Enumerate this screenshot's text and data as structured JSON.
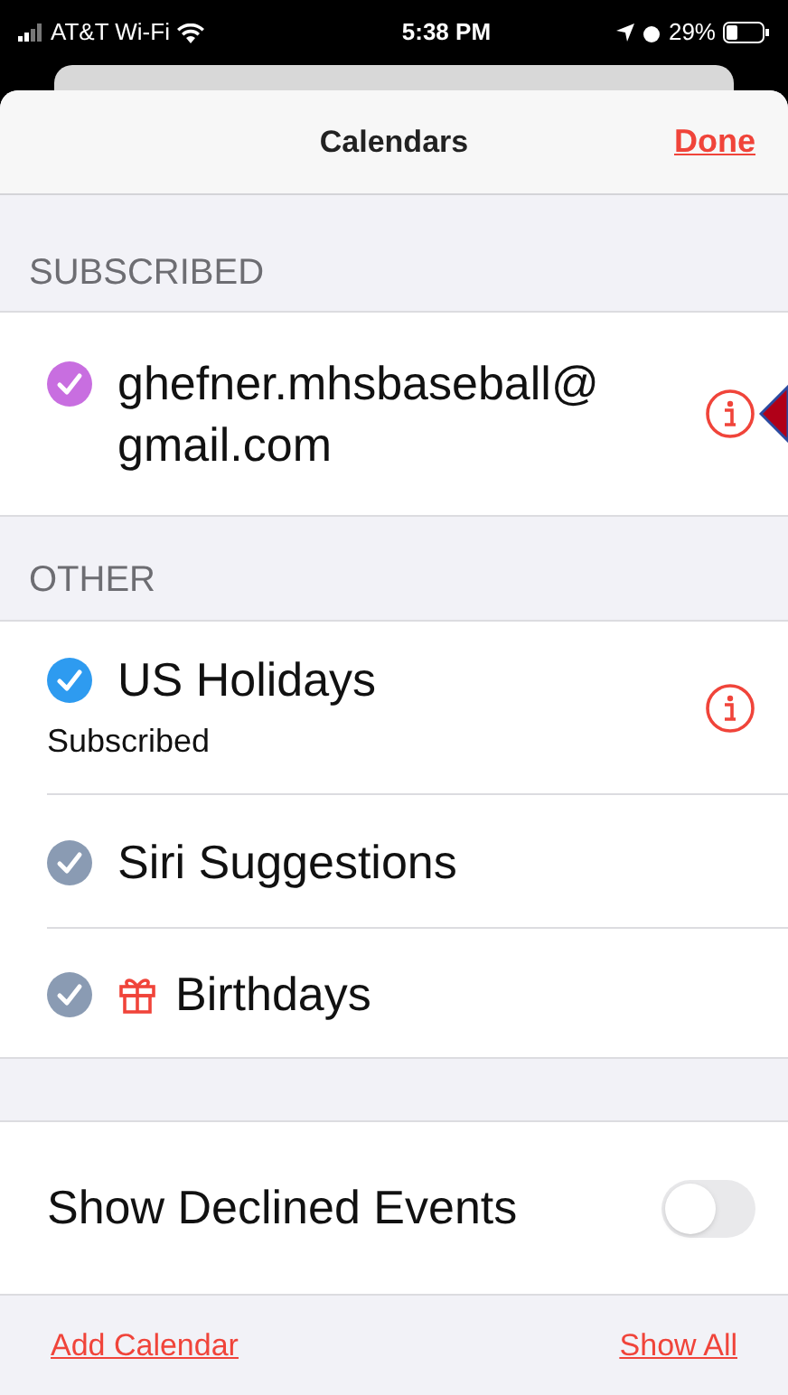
{
  "status_bar": {
    "carrier": "AT&T Wi-Fi",
    "time": "5:38 PM",
    "battery": "29%"
  },
  "header": {
    "title": "Calendars",
    "done": "Done"
  },
  "sections": [
    {
      "title": "SUBSCRIBED",
      "items": [
        {
          "kind": "plain",
          "name": "ghefner.mhsbaseball@ gmail.com",
          "checked": true,
          "color": "#c86ee0",
          "info_button": true
        }
      ]
    },
    {
      "title": "OTHER",
      "items": [
        {
          "kind": "plain",
          "name": "US Holidays",
          "subtitle": "Subscribed",
          "checked": true,
          "color": "#2e9bf0",
          "info_button": true
        },
        {
          "kind": "plain",
          "name": "Siri Suggestions",
          "checked": true,
          "color": "#8a9bb3",
          "info_button": false
        },
        {
          "kind": "gift",
          "name": "Birthdays",
          "checked": true,
          "color": "#8a9bb3",
          "info_button": false
        }
      ]
    }
  ],
  "declined": {
    "label": "Show Declined Events",
    "on": false
  },
  "footer": {
    "add": "Add Calendar",
    "show_all": "Show All"
  }
}
